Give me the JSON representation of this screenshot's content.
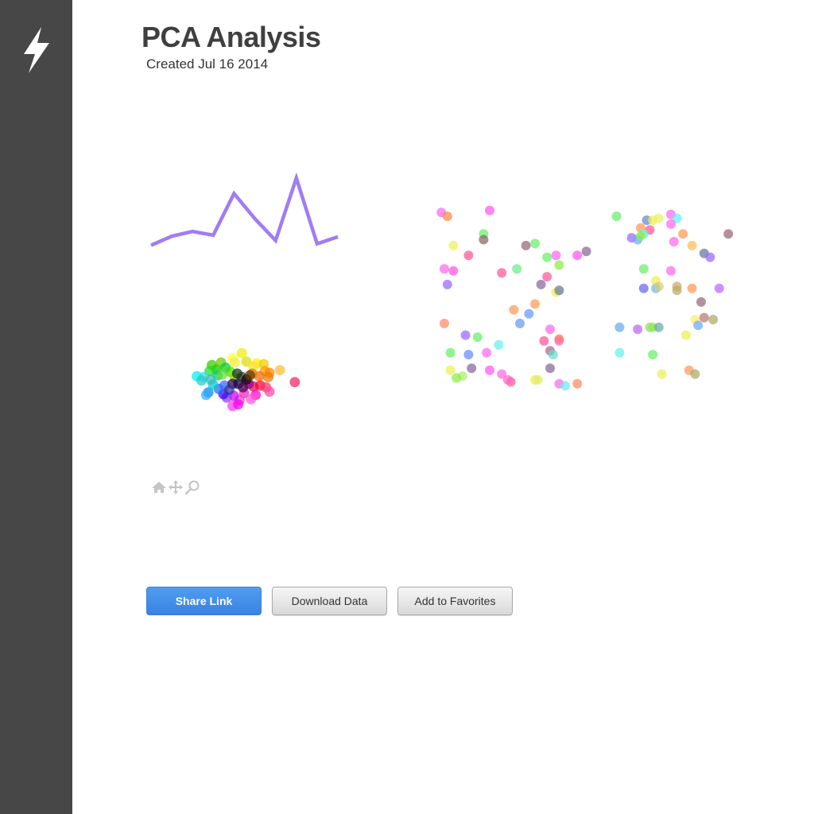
{
  "sidebar": {
    "logo_icon": "lightning-bolt-icon"
  },
  "header": {
    "title": "PCA Analysis",
    "subtitle": "Created Jul 16 2014"
  },
  "toolbar": {
    "icons": [
      "home-icon",
      "pan-arrows-icon",
      "zoom-magnifier-icon"
    ]
  },
  "actions": {
    "share_label": "Share Link",
    "download_label": "Download Data",
    "favorites_label": "Add to Favorites"
  },
  "colors": {
    "sidebar": "#474747",
    "title": "#3f3f3f",
    "line": "#a07cf5",
    "primary_button": "#3d8be6",
    "toolbar_icons": "#c4c4c4"
  },
  "chart_data": [
    {
      "type": "line",
      "x": [
        0,
        1,
        2,
        3,
        4,
        5,
        6,
        7,
        8,
        9
      ],
      "values": [
        0.05,
        0.22,
        0.31,
        0.24,
        1.02,
        0.55,
        0.14,
        1.31,
        0.08,
        0.21
      ],
      "ylim": [
        0,
        1.4
      ]
    },
    {
      "type": "scatter",
      "xlim": [
        -3,
        3
      ],
      "ylim": [
        -3,
        3
      ],
      "points": [
        {
          "x": -1.3,
          "y": 0.6,
          "color": "#00cc00"
        },
        {
          "x": -1.5,
          "y": 0.85,
          "color": "#33cc00"
        },
        {
          "x": -1.1,
          "y": 1.0,
          "color": "#66cc00"
        },
        {
          "x": -0.9,
          "y": 0.7,
          "color": "#00cc33"
        },
        {
          "x": -1.25,
          "y": 0.25,
          "color": "#00cc66"
        },
        {
          "x": -0.7,
          "y": 0.45,
          "color": "#44dd00"
        },
        {
          "x": -1.6,
          "y": 0.5,
          "color": "#22dd22"
        },
        {
          "x": -1.05,
          "y": 0.3,
          "color": "#66dd33"
        },
        {
          "x": -0.5,
          "y": 0.1,
          "color": "#99cc00"
        },
        {
          "x": -0.2,
          "y": 1.55,
          "color": "#eeee00"
        },
        {
          "x": 0.0,
          "y": 1.05,
          "color": "#dddd00"
        },
        {
          "x": 0.45,
          "y": 0.95,
          "color": "#ffee00"
        },
        {
          "x": 0.75,
          "y": 0.9,
          "color": "#eecc00"
        },
        {
          "x": 0.3,
          "y": 0.75,
          "color": "#ffdd33"
        },
        {
          "x": 1.45,
          "y": 0.55,
          "color": "#ffbb33"
        },
        {
          "x": -0.6,
          "y": 1.25,
          "color": "#ffff33"
        },
        {
          "x": -0.5,
          "y": 1.0,
          "color": "#eeee44"
        },
        {
          "x": 0.8,
          "y": 0.5,
          "color": "#ff9900"
        },
        {
          "x": 1.0,
          "y": 0.4,
          "color": "#ff8800"
        },
        {
          "x": 0.55,
          "y": 0.2,
          "color": "#ff6600"
        },
        {
          "x": 0.95,
          "y": 0.15,
          "color": "#ee7700"
        },
        {
          "x": 0.25,
          "y": 0.35,
          "color": "#cc8800"
        },
        {
          "x": 0.6,
          "y": -0.35,
          "color": "#ff0033"
        },
        {
          "x": 0.85,
          "y": -0.45,
          "color": "#ff3366"
        },
        {
          "x": 0.3,
          "y": -0.4,
          "color": "#ee0044"
        },
        {
          "x": 2.1,
          "y": -0.15,
          "color": "#ee2266"
        },
        {
          "x": 1.0,
          "y": -0.7,
          "color": "#ff44aa"
        },
        {
          "x": 0.4,
          "y": -0.9,
          "color": "#ff00cc"
        },
        {
          "x": -0.1,
          "y": -0.8,
          "color": "#ee22bb"
        },
        {
          "x": -0.3,
          "y": -1.2,
          "color": "#ff33cc"
        },
        {
          "x": 0.2,
          "y": -1.15,
          "color": "#ff55dd"
        },
        {
          "x": -0.55,
          "y": -0.95,
          "color": "#cc00ff"
        },
        {
          "x": -0.85,
          "y": -1.05,
          "color": "#9933ff"
        },
        {
          "x": -0.6,
          "y": -1.55,
          "color": "#ff33ee"
        },
        {
          "x": -0.35,
          "y": -1.45,
          "color": "#ee00ee"
        },
        {
          "x": 0.1,
          "y": -0.25,
          "color": "#990099"
        },
        {
          "x": -1.0,
          "y": -0.85,
          "color": "#3300ff"
        },
        {
          "x": -1.2,
          "y": -0.55,
          "color": "#2266ff"
        },
        {
          "x": -1.65,
          "y": -0.75,
          "color": "#0088ff"
        },
        {
          "x": -1.75,
          "y": -0.9,
          "color": "#33aaff"
        },
        {
          "x": -1.45,
          "y": -0.3,
          "color": "#00cccc"
        },
        {
          "x": -1.85,
          "y": 0.15,
          "color": "#33dddd"
        },
        {
          "x": -2.15,
          "y": 0.2,
          "color": "#00eeee"
        },
        {
          "x": -1.95,
          "y": -0.05,
          "color": "#22cccc"
        },
        {
          "x": -1.55,
          "y": 0.0,
          "color": "#33bbbb"
        },
        {
          "x": -0.95,
          "y": -0.35,
          "color": "#3366ff"
        },
        {
          "x": -0.35,
          "y": -0.25,
          "color": "#000066"
        },
        {
          "x": -0.2,
          "y": 0.15,
          "color": "#333333"
        },
        {
          "x": 0.0,
          "y": 0.0,
          "color": "#000000"
        },
        {
          "x": -0.6,
          "y": -0.25,
          "color": "#220044"
        },
        {
          "x": -0.15,
          "y": -0.45,
          "color": "#440044"
        },
        {
          "x": 0.15,
          "y": 0.25,
          "color": "#663300"
        },
        {
          "x": -0.4,
          "y": 0.35,
          "color": "#113311"
        },
        {
          "x": -0.75,
          "y": -0.6,
          "color": "#333399"
        }
      ]
    },
    {
      "type": "scatter",
      "xlim": [
        0,
        100
      ],
      "ylim": [
        0,
        100
      ],
      "points": [
        {
          "x": 4,
          "y": 95,
          "color": "#ff66ee"
        },
        {
          "x": 6,
          "y": 93,
          "color": "#ff8844"
        },
        {
          "x": 20,
          "y": 96,
          "color": "#ff55ee"
        },
        {
          "x": 18,
          "y": 84,
          "color": "#66ee66"
        },
        {
          "x": 18,
          "y": 81,
          "color": "#886666"
        },
        {
          "x": 8,
          "y": 78,
          "color": "#eeee55"
        },
        {
          "x": 13,
          "y": 73,
          "color": "#ff5599"
        },
        {
          "x": 5,
          "y": 66,
          "color": "#ff66ee"
        },
        {
          "x": 8,
          "y": 65,
          "color": "#ff55dd"
        },
        {
          "x": 6,
          "y": 58,
          "color": "#9966ff"
        },
        {
          "x": 32,
          "y": 78,
          "color": "#996677"
        },
        {
          "x": 35,
          "y": 79,
          "color": "#66ee66"
        },
        {
          "x": 24,
          "y": 64,
          "color": "#ff5599"
        },
        {
          "x": 29,
          "y": 66,
          "color": "#66ee88"
        },
        {
          "x": 39,
          "y": 72,
          "color": "#66ee66"
        },
        {
          "x": 42,
          "y": 73,
          "color": "#ff66ee"
        },
        {
          "x": 43,
          "y": 68,
          "color": "#88ee44"
        },
        {
          "x": 49,
          "y": 73,
          "color": "#ff55ee"
        },
        {
          "x": 52,
          "y": 75,
          "color": "#886699"
        },
        {
          "x": 39,
          "y": 62,
          "color": "#ff5599"
        },
        {
          "x": 37,
          "y": 58,
          "color": "#886699"
        },
        {
          "x": 42,
          "y": 54,
          "color": "#eeee55"
        },
        {
          "x": 43,
          "y": 55,
          "color": "#667799"
        },
        {
          "x": 35,
          "y": 48,
          "color": "#ff9955"
        },
        {
          "x": 28,
          "y": 45,
          "color": "#ff9955"
        },
        {
          "x": 33,
          "y": 43,
          "color": "#6699ff"
        },
        {
          "x": 30,
          "y": 38,
          "color": "#6699ee"
        },
        {
          "x": 5,
          "y": 38,
          "color": "#ff8866"
        },
        {
          "x": 12,
          "y": 32,
          "color": "#9966ff"
        },
        {
          "x": 16,
          "y": 31,
          "color": "#66ee66"
        },
        {
          "x": 23,
          "y": 27,
          "color": "#66eeee"
        },
        {
          "x": 40,
          "y": 35,
          "color": "#ff66ee"
        },
        {
          "x": 38,
          "y": 29,
          "color": "#ff5599"
        },
        {
          "x": 43,
          "y": 29,
          "color": "#ff66ee"
        },
        {
          "x": 43,
          "y": 30,
          "color": "#ff7766"
        },
        {
          "x": 40,
          "y": 24,
          "color": "#aa6688"
        },
        {
          "x": 41,
          "y": 22,
          "color": "#66ddcc"
        },
        {
          "x": 7,
          "y": 23,
          "color": "#66ee66"
        },
        {
          "x": 13,
          "y": 22,
          "color": "#6688ff"
        },
        {
          "x": 19,
          "y": 23,
          "color": "#ff66ee"
        },
        {
          "x": 7,
          "y": 14,
          "color": "#eeee55"
        },
        {
          "x": 14,
          "y": 15,
          "color": "#886699"
        },
        {
          "x": 20,
          "y": 14,
          "color": "#ff55ee"
        },
        {
          "x": 24,
          "y": 12,
          "color": "#ff66ee"
        },
        {
          "x": 11,
          "y": 11,
          "color": "#aaee66"
        },
        {
          "x": 9,
          "y": 10,
          "color": "#88ee44"
        },
        {
          "x": 27,
          "y": 8,
          "color": "#ff5599"
        },
        {
          "x": 26,
          "y": 9,
          "color": "#ff66cc"
        },
        {
          "x": 35,
          "y": 9,
          "color": "#eeee55"
        },
        {
          "x": 36,
          "y": 9,
          "color": "#ddee66"
        },
        {
          "x": 40,
          "y": 15,
          "color": "#886699"
        },
        {
          "x": 43,
          "y": 7,
          "color": "#ff66ee"
        },
        {
          "x": 45,
          "y": 6,
          "color": "#66eeee"
        },
        {
          "x": 49,
          "y": 7,
          "color": "#ff8866"
        },
        {
          "x": 62,
          "y": 93,
          "color": "#66ee66"
        },
        {
          "x": 72,
          "y": 91,
          "color": "#6688cc"
        },
        {
          "x": 74,
          "y": 91,
          "color": "#eeee55"
        },
        {
          "x": 76,
          "y": 92,
          "color": "#eeee66"
        },
        {
          "x": 80,
          "y": 94,
          "color": "#ff66ee"
        },
        {
          "x": 82,
          "y": 92,
          "color": "#66eeee"
        },
        {
          "x": 80,
          "y": 89,
          "color": "#ff66ee"
        },
        {
          "x": 70,
          "y": 87,
          "color": "#ff9955"
        },
        {
          "x": 73,
          "y": 86,
          "color": "#ff5599"
        },
        {
          "x": 71,
          "y": 84,
          "color": "#66eedd"
        },
        {
          "x": 67,
          "y": 82,
          "color": "#9966ff"
        },
        {
          "x": 69,
          "y": 81,
          "color": "#66aaff"
        },
        {
          "x": 70,
          "y": 83,
          "color": "#88ee44"
        },
        {
          "x": 84,
          "y": 84,
          "color": "#ff9955"
        },
        {
          "x": 81,
          "y": 80,
          "color": "#ff66ee"
        },
        {
          "x": 87,
          "y": 78,
          "color": "#ffbb55"
        },
        {
          "x": 91,
          "y": 74,
          "color": "#667799"
        },
        {
          "x": 93,
          "y": 72,
          "color": "#9966ff"
        },
        {
          "x": 99,
          "y": 84,
          "color": "#996677"
        },
        {
          "x": 71,
          "y": 66,
          "color": "#66ee66"
        },
        {
          "x": 80,
          "y": 65,
          "color": "#ff66ee"
        },
        {
          "x": 75,
          "y": 60,
          "color": "#eeee55"
        },
        {
          "x": 71,
          "y": 56,
          "color": "#6666ee"
        },
        {
          "x": 75,
          "y": 56,
          "color": "#66bbee"
        },
        {
          "x": 76,
          "y": 57,
          "color": "#ddcc77"
        },
        {
          "x": 82,
          "y": 57,
          "color": "#ccaa66"
        },
        {
          "x": 82,
          "y": 55,
          "color": "#bbaa66"
        },
        {
          "x": 87,
          "y": 56,
          "color": "#ff9955"
        },
        {
          "x": 96,
          "y": 56,
          "color": "#bb66ff"
        },
        {
          "x": 90,
          "y": 49,
          "color": "#996677"
        },
        {
          "x": 88,
          "y": 40,
          "color": "#ffee66"
        },
        {
          "x": 91,
          "y": 41,
          "color": "#bb7777"
        },
        {
          "x": 94,
          "y": 40,
          "color": "#aaaa66"
        },
        {
          "x": 89,
          "y": 37,
          "color": "#66aaff"
        },
        {
          "x": 63,
          "y": 36,
          "color": "#66aaee"
        },
        {
          "x": 69,
          "y": 35,
          "color": "#bb66ee"
        },
        {
          "x": 73,
          "y": 36,
          "color": "#99dd66"
        },
        {
          "x": 74,
          "y": 36,
          "color": "#88ee44"
        },
        {
          "x": 76,
          "y": 36,
          "color": "#66aaaa"
        },
        {
          "x": 85,
          "y": 32,
          "color": "#eeee55"
        },
        {
          "x": 63,
          "y": 23,
          "color": "#66eeee"
        },
        {
          "x": 74,
          "y": 22,
          "color": "#66ee66"
        },
        {
          "x": 86,
          "y": 14,
          "color": "#ff9955"
        },
        {
          "x": 88,
          "y": 12,
          "color": "#aaaa66"
        },
        {
          "x": 77,
          "y": 12,
          "color": "#eeee55"
        }
      ]
    }
  ]
}
